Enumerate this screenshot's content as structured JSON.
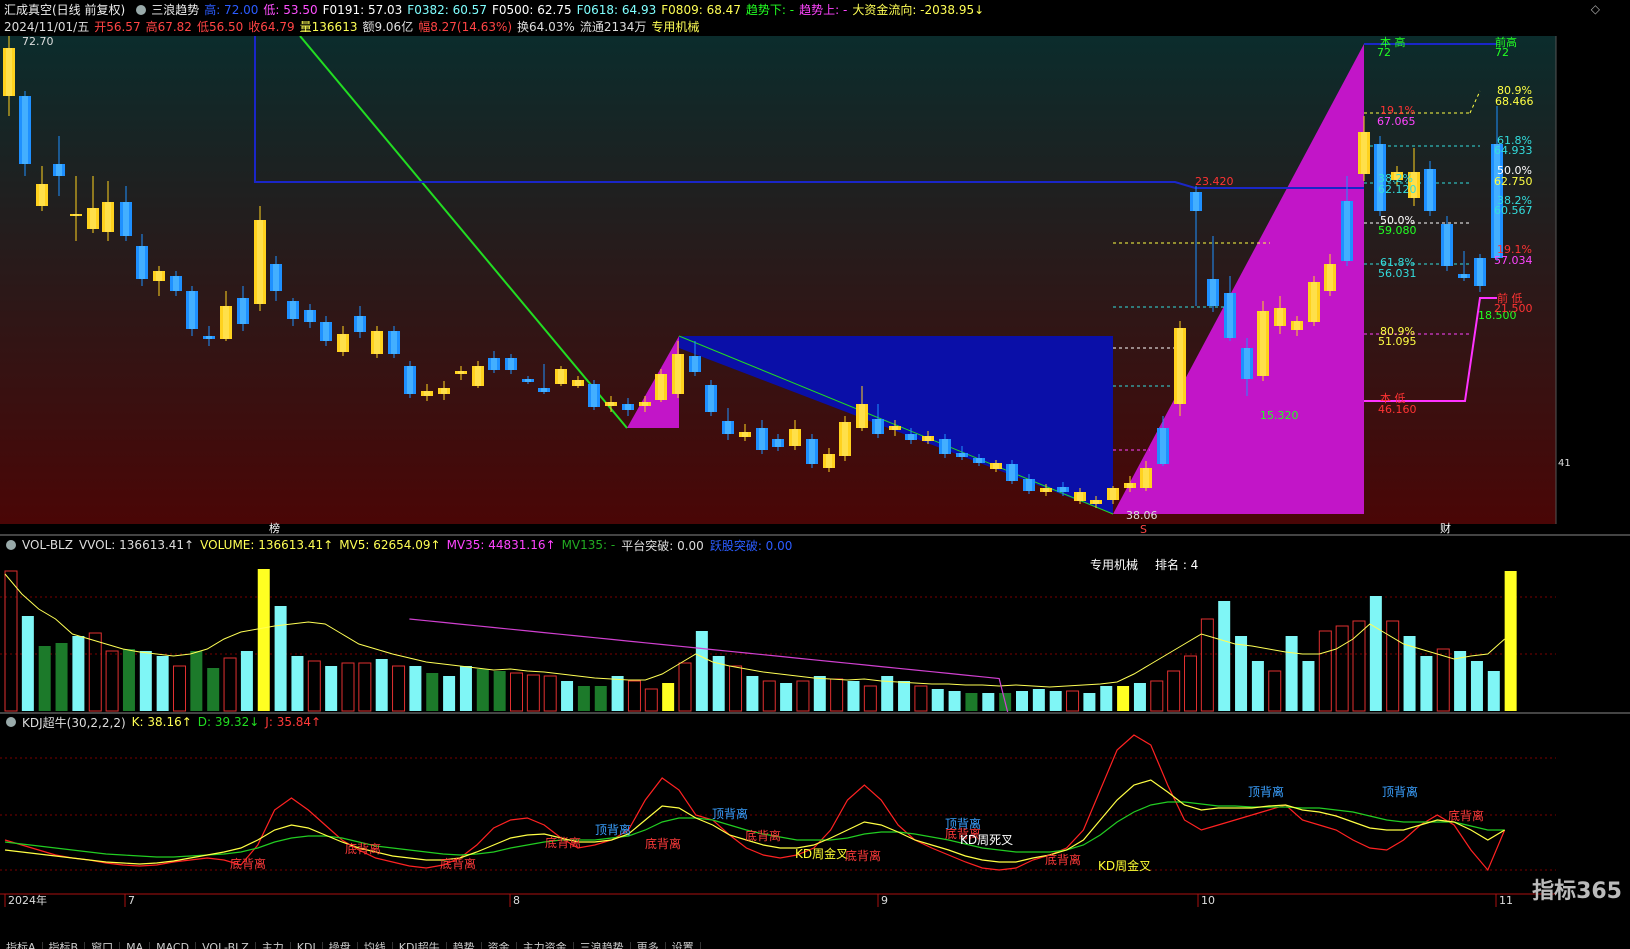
{
  "header": {
    "stock": "汇成真空(日线 前复权)",
    "indicator": "三浪趋势",
    "high_label": "高: 72.00",
    "low_label": "低: 53.50",
    "f0191": "F0191: 57.03",
    "f0382": "F0382: 60.57",
    "f0500": "F0500: 62.75",
    "f0618": "F0618: 64.93",
    "f0809": "F0809: 68.47",
    "trend_down": "趋势下: -",
    "trend_up": "趋势上: -",
    "capital_flow": "大资金流向: -2038.95↓"
  },
  "quote": {
    "date": "2024/11/01/五",
    "open": "开56.57",
    "high": "高67.82",
    "low": "低56.50",
    "close": "收64.79",
    "volume": "量136613",
    "amount": "额9.06亿",
    "change": "幅8.27(14.63%)",
    "turnover": "换64.03%",
    "float": "流通2134万",
    "sector": "专用机械"
  },
  "main_chart": {
    "price_max_label": "72.70",
    "price_min_label": "38.06",
    "annotations": [
      "本 高",
      "72",
      "前高",
      "72",
      "80.9%",
      "68.466",
      "19.1%",
      "67.065",
      "61.8%",
      "64.933",
      "23.420",
      "38.2%",
      "62.120",
      "50.0%",
      "62.750",
      "38.2%",
      "60.567",
      "50.0%",
      "59.080",
      "19.1%",
      "57.034",
      "61.8%",
      "56.031",
      "前 低",
      "18.500",
      "21.500",
      "80.9%",
      "51.095",
      "本 低",
      "46.160",
      "15.320"
    ],
    "markers": {
      "bang": "榜",
      "cai": "财",
      "s": "S"
    }
  },
  "vol_pane": {
    "name": "VOL-BLZ",
    "vvol": "VVOL: 136613.41↑",
    "volume": "VOLUME: 136613.41↑",
    "mv5": "MV5: 62654.09↑",
    "mv35": "MV35: 44831.16↑",
    "mv135": "MV135: -",
    "platform": "平台突破: 0.00",
    "breakout": "跃股突破: 0.00",
    "sector_note": "专用机械",
    "rank_note": "排名 : 4"
  },
  "kdj_pane": {
    "name": "KDJ超牛(30,2,2,2)",
    "k": "K: 38.16↑",
    "d": "D: 39.32↓",
    "j": "J: 35.84↑",
    "signals": [
      {
        "text": "底背离",
        "color": "#ff3a3a"
      },
      {
        "text": "底背离",
        "color": "#ff3a3a"
      },
      {
        "text": "底背离",
        "color": "#ff3a3a"
      },
      {
        "text": "底背离",
        "color": "#ff3a3a"
      },
      {
        "text": "顶背离",
        "color": "#3aa0ff"
      },
      {
        "text": "底背离",
        "color": "#ff3a3a"
      },
      {
        "text": "顶背离",
        "color": "#3aa0ff"
      },
      {
        "text": "底背离",
        "color": "#ff3a3a"
      },
      {
        "text": "KD周金叉",
        "color": "#ffff33"
      },
      {
        "text": "底背离",
        "color": "#ff3a3a"
      },
      {
        "text": "顶背离",
        "color": "#3aa0ff"
      },
      {
        "text": "底背离",
        "color": "#ff3a3a"
      },
      {
        "text": "KD周死叉",
        "color": "#ffffff"
      },
      {
        "text": "底背离",
        "color": "#ff3a3a"
      },
      {
        "text": "KD周金叉",
        "color": "#ffff33"
      },
      {
        "text": "顶背离",
        "color": "#3aa0ff"
      },
      {
        "text": "顶背离",
        "color": "#3aa0ff"
      },
      {
        "text": "底背离",
        "color": "#ff3a3a"
      }
    ]
  },
  "time_axis": [
    "2024年",
    "7",
    "8",
    "9",
    "10",
    "11"
  ],
  "right_edge_label": "41",
  "watermark": "指标365",
  "tabs": [
    "指标A",
    "指标B",
    "窗口",
    "MA",
    "MACD",
    "VOL-BLZ",
    "主力",
    "KDJ",
    "操盘",
    "均线",
    "KDJ超牛",
    "趋势",
    "资金",
    "主力资金",
    "三浪趋势",
    "更多",
    "设置"
  ],
  "colors": {
    "up": "#ffd21e",
    "down": "#1e90ff",
    "trend_fill": "#c215c8",
    "box_fill": "#0a0fa8",
    "line_green": "#22dd22",
    "line_blue": "#1a26c8"
  }
}
